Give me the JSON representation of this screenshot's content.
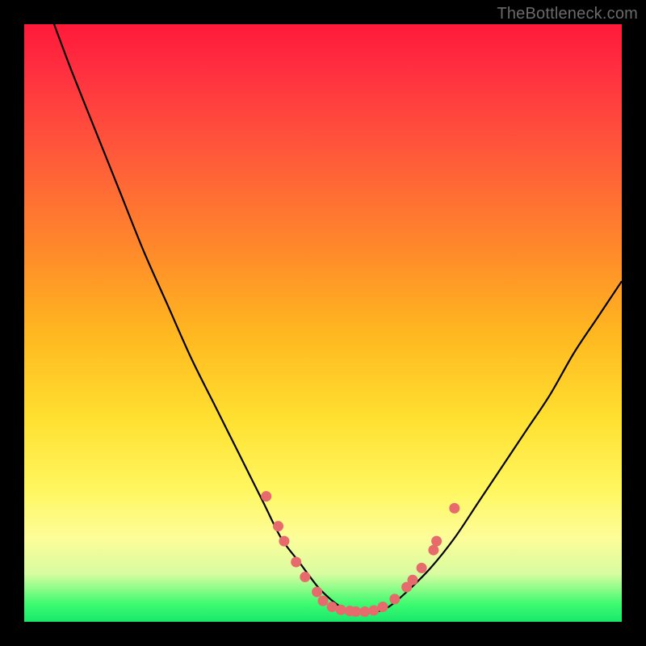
{
  "watermark": "TheBottleneck.com",
  "colors": {
    "curve_stroke": "#000000",
    "dot_fill": "#e76a6c",
    "frame_bg": "#000000"
  },
  "chart_data": {
    "type": "line",
    "title": "",
    "xlabel": "",
    "ylabel": "",
    "xlim": [
      0,
      100
    ],
    "ylim": [
      0,
      100
    ],
    "series": [
      {
        "name": "bottleneck-curve",
        "x": [
          5,
          8,
          12,
          16,
          20,
          24,
          28,
          32,
          36,
          40,
          43,
          46,
          49,
          51,
          53,
          55,
          57,
          59,
          61,
          64,
          68,
          72,
          76,
          80,
          84,
          88,
          92,
          96,
          100
        ],
        "y": [
          100,
          92,
          82,
          72,
          62,
          53,
          44,
          36,
          28,
          20,
          14,
          10,
          6,
          4,
          2.5,
          1.8,
          1.5,
          1.7,
          2.5,
          5,
          9,
          14,
          20,
          26,
          32,
          38,
          45,
          51,
          57
        ]
      }
    ],
    "dots": {
      "name": "highlight-dots",
      "points": [
        {
          "x": 40.5,
          "y": 21
        },
        {
          "x": 42.5,
          "y": 16
        },
        {
          "x": 43.5,
          "y": 13.5
        },
        {
          "x": 45.5,
          "y": 10
        },
        {
          "x": 47.0,
          "y": 7.5
        },
        {
          "x": 49.0,
          "y": 5.0
        },
        {
          "x": 50.0,
          "y": 3.5
        },
        {
          "x": 51.5,
          "y": 2.5
        },
        {
          "x": 53.0,
          "y": 2.0
        },
        {
          "x": 54.5,
          "y": 1.8
        },
        {
          "x": 55.5,
          "y": 1.7
        },
        {
          "x": 57.0,
          "y": 1.7
        },
        {
          "x": 58.5,
          "y": 1.9
        },
        {
          "x": 60.0,
          "y": 2.5
        },
        {
          "x": 62.0,
          "y": 3.8
        },
        {
          "x": 64.0,
          "y": 5.8
        },
        {
          "x": 65.0,
          "y": 7.0
        },
        {
          "x": 66.5,
          "y": 9.0
        },
        {
          "x": 68.5,
          "y": 12.0
        },
        {
          "x": 69.0,
          "y": 13.5
        },
        {
          "x": 72.0,
          "y": 19.0
        }
      ]
    }
  }
}
